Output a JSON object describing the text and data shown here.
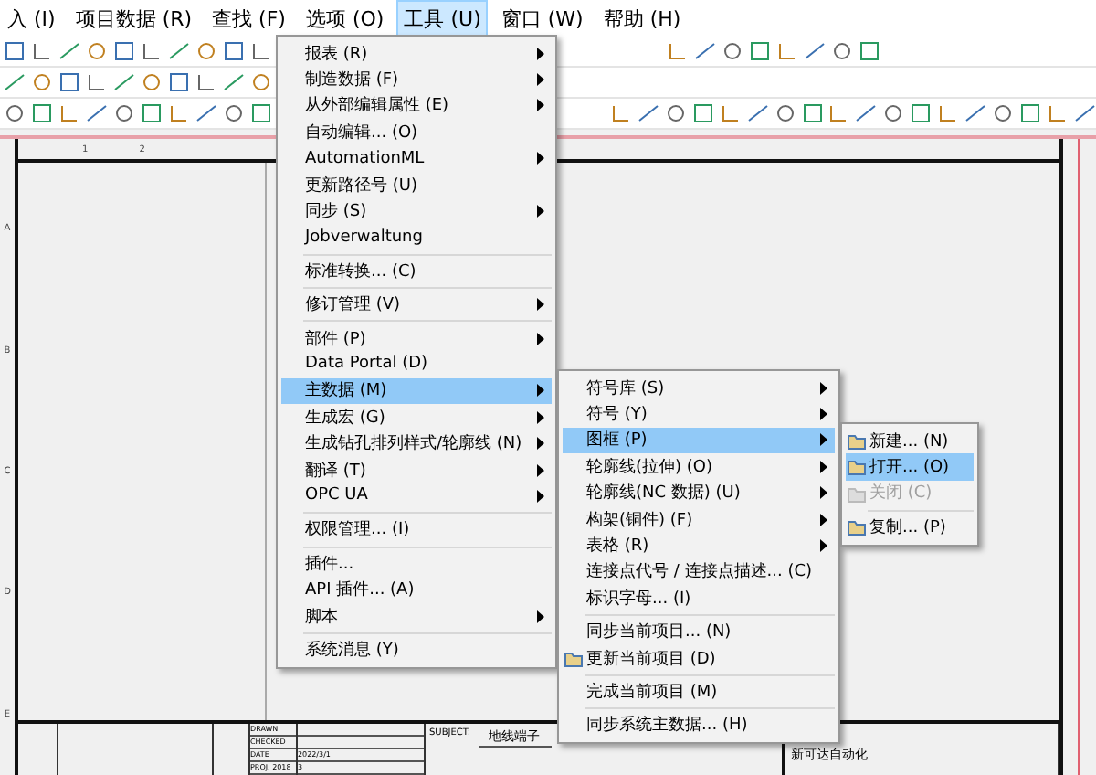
{
  "menubar": [
    {
      "label": "入 (I)",
      "selected": false
    },
    {
      "label": "项目数据 (R)",
      "selected": false
    },
    {
      "label": "查找 (F)",
      "selected": false
    },
    {
      "label": "选项 (O)",
      "selected": false
    },
    {
      "label": "工具 (U)",
      "selected": true
    },
    {
      "label": "窗口 (W)",
      "selected": false
    },
    {
      "label": "帮助 (H)",
      "selected": false
    }
  ],
  "drawing": {
    "columns": [
      "1",
      "2"
    ],
    "rows": [
      "A",
      "B",
      "C",
      "D",
      "E"
    ],
    "title_block": {
      "rows": [
        {
          "label": "DRAWN"
        },
        {
          "label": "CHECKED"
        },
        {
          "label": "DATE",
          "value": "2022/3/1"
        },
        {
          "label": "PROJ. 2018",
          "value": "3"
        }
      ],
      "subject_label": "SUBJECT:",
      "subject": "地线端子",
      "company": "新可达自动化"
    }
  },
  "tools_menu": [
    {
      "kind": "item",
      "label": "报表 (R)",
      "submenu": true,
      "selected": false
    },
    {
      "kind": "item",
      "label": "制造数据 (F)",
      "submenu": true,
      "selected": false
    },
    {
      "kind": "item",
      "label": "从外部编辑属性 (E)",
      "submenu": true,
      "selected": false
    },
    {
      "kind": "item",
      "label": "自动编辑... (O)",
      "submenu": false,
      "selected": false
    },
    {
      "kind": "item",
      "label": "AutomationML",
      "submenu": true,
      "selected": false
    },
    {
      "kind": "item",
      "label": "更新路径号 (U)",
      "submenu": false,
      "selected": false
    },
    {
      "kind": "item",
      "label": "同步 (S)",
      "submenu": true,
      "selected": false
    },
    {
      "kind": "item",
      "label": "Jobverwaltung",
      "submenu": false,
      "selected": false
    },
    {
      "kind": "separator"
    },
    {
      "kind": "item",
      "label": "标准转换... (C)",
      "submenu": false,
      "selected": false
    },
    {
      "kind": "separator"
    },
    {
      "kind": "item",
      "label": "修订管理 (V)",
      "submenu": true,
      "selected": false
    },
    {
      "kind": "separator"
    },
    {
      "kind": "item",
      "label": "部件 (P)",
      "submenu": true,
      "selected": false
    },
    {
      "kind": "item",
      "label": "Data Portal (D)",
      "submenu": false,
      "selected": false
    },
    {
      "kind": "item",
      "label": "主数据 (M)",
      "submenu": true,
      "selected": true
    },
    {
      "kind": "item",
      "label": "生成宏 (G)",
      "submenu": true,
      "selected": false
    },
    {
      "kind": "item",
      "label": "生成钻孔排列样式/轮廓线 (N)",
      "submenu": true,
      "selected": false
    },
    {
      "kind": "item",
      "label": "翻译 (T)",
      "submenu": true,
      "selected": false
    },
    {
      "kind": "item",
      "label": "OPC UA",
      "submenu": true,
      "selected": false
    },
    {
      "kind": "separator"
    },
    {
      "kind": "item",
      "label": "权限管理... (I)",
      "submenu": false,
      "selected": false
    },
    {
      "kind": "separator"
    },
    {
      "kind": "item",
      "label": "插件...",
      "submenu": false,
      "selected": false
    },
    {
      "kind": "item",
      "label": "API 插件... (A)",
      "submenu": false,
      "selected": false
    },
    {
      "kind": "item",
      "label": "脚本",
      "submenu": true,
      "selected": false
    },
    {
      "kind": "separator"
    },
    {
      "kind": "item",
      "label": "系统消息 (Y)",
      "submenu": false,
      "selected": false
    }
  ],
  "master_data_menu": [
    {
      "kind": "item",
      "label": "符号库 (S)",
      "submenu": true,
      "selected": false
    },
    {
      "kind": "item",
      "label": "符号 (Y)",
      "submenu": true,
      "selected": false
    },
    {
      "kind": "item",
      "label": "图框 (P)",
      "submenu": true,
      "selected": true
    },
    {
      "kind": "item",
      "label": "轮廓线(拉伸) (O)",
      "submenu": true,
      "selected": false
    },
    {
      "kind": "item",
      "label": "轮廓线(NC 数据) (U)",
      "submenu": true,
      "selected": false
    },
    {
      "kind": "item",
      "label": "构架(铜件) (F)",
      "submenu": true,
      "selected": false
    },
    {
      "kind": "item",
      "label": "表格 (R)",
      "submenu": true,
      "selected": false
    },
    {
      "kind": "item",
      "label": "连接点代号 / 连接点描述... (C)",
      "submenu": false,
      "selected": false
    },
    {
      "kind": "item",
      "label": "标识字母... (I)",
      "submenu": false,
      "selected": false
    },
    {
      "kind": "separator"
    },
    {
      "kind": "item",
      "label": "同步当前项目... (N)",
      "submenu": false,
      "selected": false
    },
    {
      "kind": "item",
      "label": "更新当前项目 (D)",
      "submenu": false,
      "selected": false,
      "icon": true
    },
    {
      "kind": "separator"
    },
    {
      "kind": "item",
      "label": "完成当前项目 (M)",
      "submenu": false,
      "selected": false
    },
    {
      "kind": "separator"
    },
    {
      "kind": "item",
      "label": "同步系统主数据... (H)",
      "submenu": false,
      "selected": false
    }
  ],
  "frame_menu": [
    {
      "kind": "item",
      "label": "新建... (N)",
      "selected": false,
      "disabled": false,
      "icon": true
    },
    {
      "kind": "item",
      "label": "打开... (O)",
      "selected": true,
      "disabled": false,
      "icon": true
    },
    {
      "kind": "item",
      "label": "关闭 (C)",
      "selected": false,
      "disabled": true,
      "icon": true
    },
    {
      "kind": "separator"
    },
    {
      "kind": "item",
      "label": "复制... (P)",
      "selected": false,
      "disabled": false,
      "icon": true
    }
  ]
}
